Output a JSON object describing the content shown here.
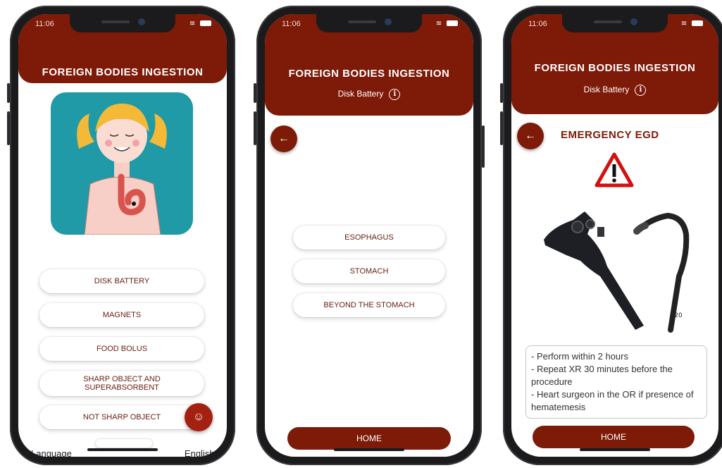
{
  "app_title": "FOREIGN BODIES INGESTION",
  "status_bar": {
    "time": "11:06"
  },
  "screen1": {
    "menu_items": [
      "DISK BATTERY",
      "MAGNETS",
      "FOOD BOLUS",
      "SHARP OBJECT AND SUPERABSORBENT",
      "NOT SHARP OBJECT"
    ],
    "language_label": "Language",
    "language_value": "English",
    "chat_icon": "chat-bubble-icon",
    "illustration": "girl-stomach-illustration"
  },
  "screen2": {
    "subtitle": "Disk Battery",
    "options": [
      "ESOPHAGUS",
      "STOMACH",
      "BEYOND THE STOMACH"
    ],
    "home_label": "HOME"
  },
  "screen3": {
    "subtitle": "Disk Battery",
    "heading": "EMERGENCY EGD",
    "notes": [
      "- Perform within 2 hours",
      "- Repeat XR 30 minutes before the procedure",
      "- Heart surgeon in the OR if presence of hematemesis"
    ],
    "home_label": "HOME",
    "warning_icon": "warning-triangle-icon",
    "image": "endoscope-image"
  },
  "colors": {
    "brand": "#7d1a08",
    "fab": "#a42010",
    "pill_text": "#6a2116"
  }
}
